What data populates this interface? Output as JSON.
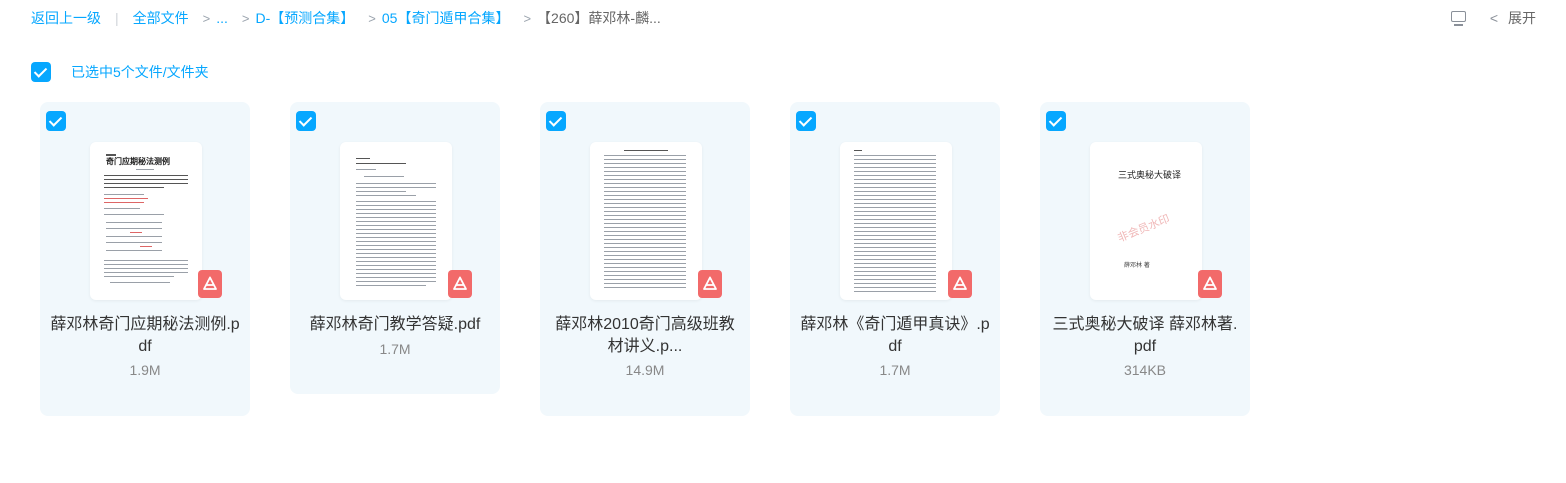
{
  "breadcrumb": {
    "back": "返回上一级",
    "all_files": "全部文件",
    "ellipsis": "...",
    "level1": "D-【预测合集】",
    "level2": "05【奇门遁甲合集】",
    "current": "【260】薛邓林-麟..."
  },
  "toolbar": {
    "expand_label": "展开"
  },
  "selection": {
    "label": "已选中5个文件/文件夹"
  },
  "files": [
    {
      "name": "薛邓林奇门应期秘法测例.pdf",
      "size": "1.9M",
      "icon": "pdf-icon"
    },
    {
      "name": "薛邓林奇门教学答疑.pdf",
      "size": "1.7M",
      "icon": "pdf-icon"
    },
    {
      "name": "薛邓林2010奇门高级班教材讲义.p...",
      "size": "14.9M",
      "icon": "pdf-icon"
    },
    {
      "name": "薛邓林《奇门遁甲真诀》.pdf",
      "size": "1.7M",
      "icon": "pdf-icon"
    },
    {
      "name": "三式奥秘大破译 薛邓林著.pdf",
      "size": "314KB",
      "icon": "pdf-icon"
    }
  ],
  "thumbnails": {
    "file1_title": "奇门应期秘法测例",
    "file5_title": "三式奥秘大破译",
    "file5_author": "薛邓林 著",
    "file5_watermark": "非会员水印"
  },
  "colors": {
    "accent": "#06a7ff",
    "card_bg": "#f1f8fc",
    "pdf_badge": "#f26a6a"
  }
}
